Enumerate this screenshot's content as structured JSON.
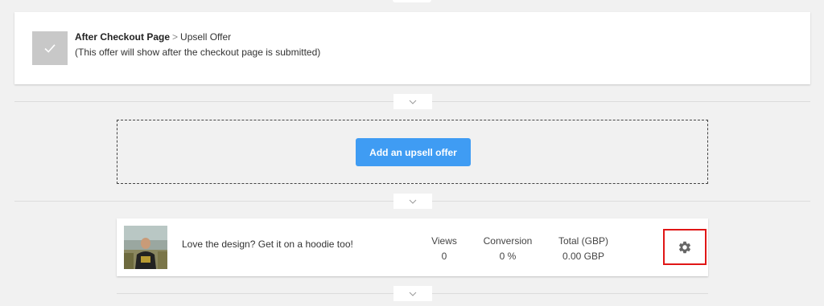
{
  "checkout": {
    "title": "After Checkout Page",
    "breadcrumb_sep": ">",
    "subtitle_link": "Upsell Offer",
    "description": "(This offer will show after the checkout page is submitted)"
  },
  "upsell": {
    "add_button_label": "Add an upsell offer"
  },
  "offer": {
    "text": "Love the design? Get it on a hoodie too!",
    "stats": [
      {
        "label": "Views",
        "value": "0"
      },
      {
        "label": "Conversion",
        "value": "0 %"
      },
      {
        "label": "Total (GBP)",
        "value": "0.00 GBP"
      }
    ]
  },
  "icons": {
    "check": "check-icon",
    "chevron": "chevron-down-icon",
    "settings": "gear-icon"
  },
  "colors": {
    "accent": "#3f9cf3",
    "highlight": "#e01616",
    "check_bg": "#c8c8c8"
  }
}
